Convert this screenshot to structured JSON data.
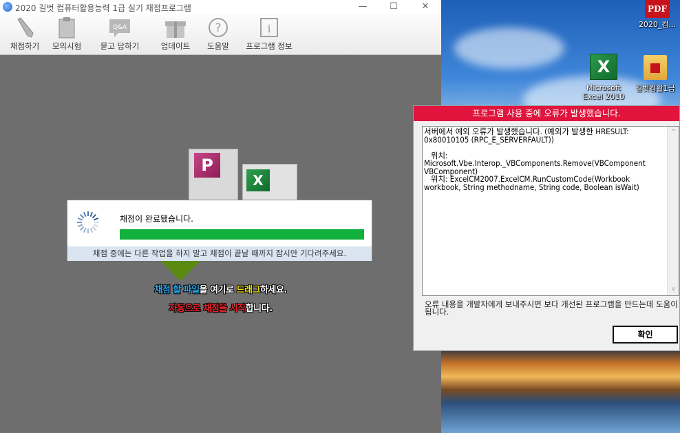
{
  "window": {
    "title": "2020 길벗 컴퓨터활용능력 1급 실기 채점프로그램",
    "minimize": "—",
    "maximize": "☐",
    "close": "✕"
  },
  "toolbar": {
    "items": [
      {
        "label": "채점하기",
        "icon": "pencil-icon"
      },
      {
        "label": "모의시험",
        "icon": "clipboard-icon"
      },
      {
        "label": "묻고 답하기",
        "icon": "qna-icon",
        "badge": "Q&A"
      },
      {
        "label": "업데이트",
        "icon": "gift-icon"
      },
      {
        "label": "도움말",
        "icon": "help-icon",
        "glyph": "?"
      },
      {
        "label": "프로그램 정보",
        "icon": "info-icon",
        "glyph": "i"
      }
    ]
  },
  "drop": {
    "line1": {
      "part1": "채점 할 파일",
      "part2": "을 여기로 ",
      "part3": "드래그",
      "part4": "하세요."
    },
    "line2": {
      "part1": "자동으로 채점을 시작",
      "part2": "합니다."
    },
    "access_glyph": "P",
    "excel_glyph": "X"
  },
  "progress": {
    "message": "채점이 완료됐습니다.",
    "percent": 100,
    "hint": "채점 중에는 다른 작업을 하지 말고 채점이 끝날 때까지 잠시만 기다려주세요."
  },
  "error_dialog": {
    "title": "프로그램 사용 중에 오류가 발생했습니다.",
    "detail": "서버에서 예외 오류가 발생했습니다. (예외가 발생한 HRESULT: 0x80010105 (RPC_E_SERVERFAULT))\n\n   위치: Microsoft.Vbe.Interop._VBComponents.Remove(VBComponent VBComponent)\n   위치: ExcelCM2007.ExcelCM.RunCustomCode(Workbook workbook, String methodname, String code, Boolean isWait)",
    "note": "오류 내용을 개발자에게 보내주시면 보다 개선된 프로그램을 만드는데 도움이 됩니다.",
    "ok_label": "확인",
    "scroll_up": "^",
    "scroll_down": "v"
  },
  "desktop": {
    "icons": [
      {
        "label": "2020_컴...",
        "glyph": "PDF",
        "icon": "pdf-icon"
      },
      {
        "label": "Microsoft Excel 2010",
        "glyph": "X",
        "icon": "excel-icon"
      },
      {
        "label": "길벗컴활1급",
        "icon": "folder-icon"
      }
    ]
  },
  "colors": {
    "error_header": "#e0143c",
    "progress_fill": "#12b03c",
    "hint_bg": "#dbe5f1"
  }
}
